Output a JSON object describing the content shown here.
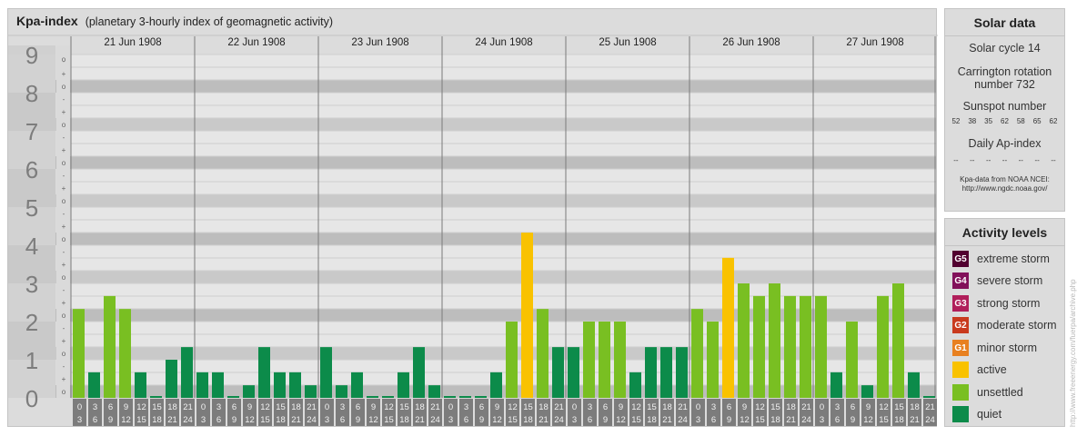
{
  "title": "Kpa-index",
  "subtitle": "(planetary 3-hourly index of geomagnetic activity)",
  "colors": {
    "quiet": "#0c8b4a",
    "unsettled": "#79bf22",
    "active": "#f9c200",
    "minor": "#e88020",
    "moderate": "#c93a1e",
    "strong": "#b01e5a",
    "severe": "#82105a",
    "extreme": "#520030"
  },
  "chart_data": {
    "type": "bar",
    "title": "Kpa-index",
    "subtitle": "(planetary 3-hourly index of geomagnetic activity)",
    "ylim": [
      0,
      9
    ],
    "y_ticks": [
      "0",
      "1",
      "2",
      "3",
      "4",
      "5",
      "6",
      "7",
      "8",
      "9"
    ],
    "sub_ticks": [
      "o",
      "+",
      "-"
    ],
    "days": [
      "21 Jun 1908",
      "22 Jun 1908",
      "23 Jun 1908",
      "24 Jun 1908",
      "25 Jun 1908",
      "26 Jun 1908",
      "27 Jun 1908"
    ],
    "hour_labels": [
      [
        "0",
        "3"
      ],
      [
        "3",
        "6"
      ],
      [
        "6",
        "9"
      ],
      [
        "9",
        "12"
      ],
      [
        "12",
        "15"
      ],
      [
        "15",
        "18"
      ],
      [
        "18",
        "21"
      ],
      [
        "21",
        "24"
      ]
    ],
    "values": [
      [
        2.33,
        0.67,
        2.67,
        2.33,
        0.67,
        0,
        1,
        1.33
      ],
      [
        0.67,
        0.67,
        0,
        0.33,
        1.33,
        0.67,
        0.67,
        0.33
      ],
      [
        1.33,
        0.33,
        0.67,
        0,
        0,
        0.67,
        1.33,
        0.33
      ],
      [
        0,
        0,
        0,
        0.67,
        2,
        4.33,
        2.33,
        1.33
      ],
      [
        1.33,
        2,
        2,
        2,
        0.67,
        1.33,
        1.33,
        1.33
      ],
      [
        2.33,
        2,
        3.67,
        3,
        2.67,
        3,
        2.67,
        2.67
      ],
      [
        2.67,
        0.67,
        2,
        0.33,
        2.67,
        3,
        0.67,
        0
      ]
    ],
    "grid": true,
    "legend_position": "right"
  },
  "solar_data": {
    "title": "Solar data",
    "solar_cycle": "Solar cycle 14",
    "carrington_line1": "Carrington rotation",
    "carrington_line2": "number 732",
    "sunspot_title": "Sunspot number",
    "sunspots": [
      "52",
      "38",
      "35",
      "62",
      "58",
      "65",
      "62"
    ],
    "ap_title": "Daily Ap-index",
    "ap_values": [
      "--",
      "--",
      "--",
      "--",
      "--",
      "--",
      "--"
    ],
    "credit_line1": "Kpa-data from NOAA NCEI:",
    "credit_line2": "http://www.ngdc.noaa.gov/"
  },
  "activity_levels": {
    "title": "Activity levels",
    "items": [
      {
        "code": "G5",
        "label": "extreme storm",
        "color": "#520030"
      },
      {
        "code": "G4",
        "label": "severe storm",
        "color": "#82105a"
      },
      {
        "code": "G3",
        "label": "strong storm",
        "color": "#b01e5a"
      },
      {
        "code": "G2",
        "label": "moderate storm",
        "color": "#c93a1e"
      },
      {
        "code": "G1",
        "label": "minor storm",
        "color": "#e88020"
      },
      {
        "code": "",
        "label": "active",
        "color": "#f9c200"
      },
      {
        "code": "",
        "label": "unsettled",
        "color": "#79bf22"
      },
      {
        "code": "",
        "label": "quiet",
        "color": "#0c8b4a"
      }
    ]
  },
  "watermark": "http://www.freeenergy.com/fuerpa/archive.php"
}
